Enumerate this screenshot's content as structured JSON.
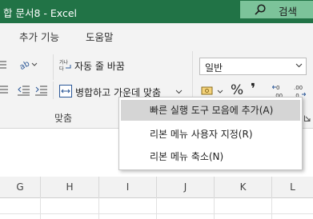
{
  "titlebar": {
    "title": "합 문서8  -  Excel",
    "search_label": "검색"
  },
  "menu": {
    "items": [
      "추가 기능",
      "도움말"
    ]
  },
  "ribbon": {
    "autosum_label_small": "가나\n다",
    "wrap_text": "자동 줄 바꿈",
    "merge_center": "병합하고 가운데 맞춤",
    "number_format": "일반",
    "percent": "%",
    "comma": "❜",
    "group_label": "맞춤"
  },
  "context_menu": {
    "items": [
      "빠른 실행 도구 모음에 추가(A)",
      "리본 메뉴 사용자 지정(R)",
      "리본 메뉴 축소(N)"
    ]
  },
  "columns": [
    "G",
    "H",
    "I",
    "J",
    "K",
    "L"
  ],
  "colors": {
    "titlebar": "#217346",
    "search": "#7cc39a",
    "ribbon": "#f3f3f3",
    "highlight": "#d5d5d5"
  }
}
